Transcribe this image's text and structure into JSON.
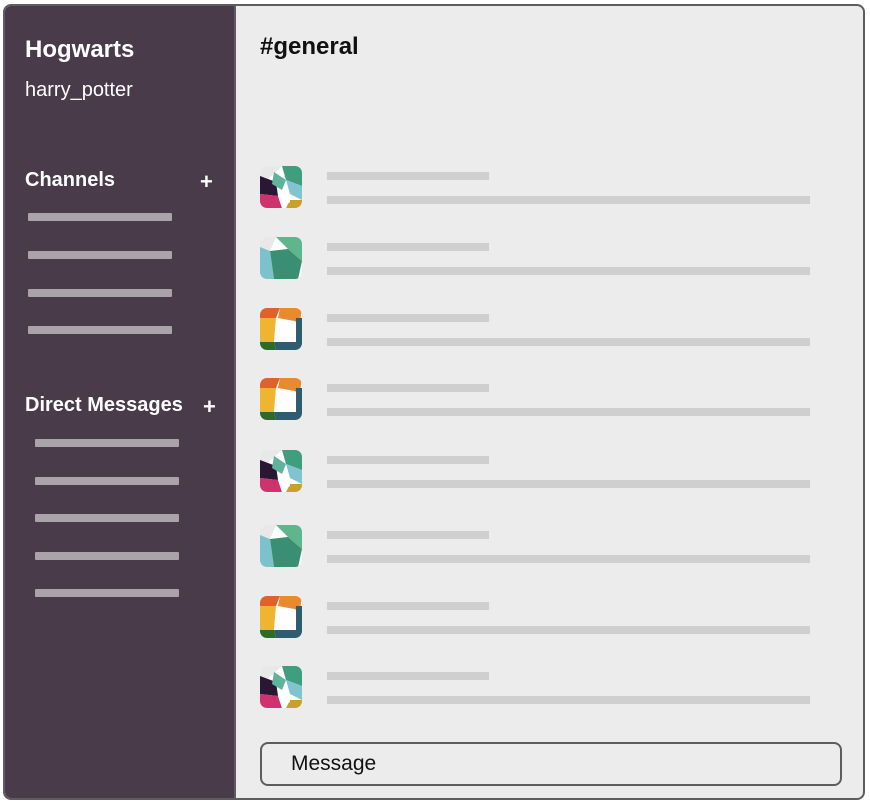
{
  "workspace": {
    "name": "Hogwarts",
    "user": "harry_potter"
  },
  "sidebar": {
    "channels": {
      "title": "Channels",
      "add": "+",
      "item_count": 4
    },
    "direct_messages": {
      "title": "Direct Messages",
      "add": "+",
      "item_count": 5
    }
  },
  "channel": {
    "title": "#general"
  },
  "messages": [
    {
      "avatar": "avatar-a"
    },
    {
      "avatar": "avatar-b"
    },
    {
      "avatar": "avatar-c"
    },
    {
      "avatar": "avatar-c"
    },
    {
      "avatar": "avatar-a"
    },
    {
      "avatar": "avatar-b"
    },
    {
      "avatar": "avatar-c"
    },
    {
      "avatar": "avatar-a"
    }
  ],
  "composer": {
    "placeholder": "Message"
  },
  "colors": {
    "sidebar": "#4a3b4b",
    "main": "#ececec",
    "border": "#5d5d5d",
    "placeholder_line": "#cfcfcf",
    "sidebar_line": "#aaa3aa"
  }
}
